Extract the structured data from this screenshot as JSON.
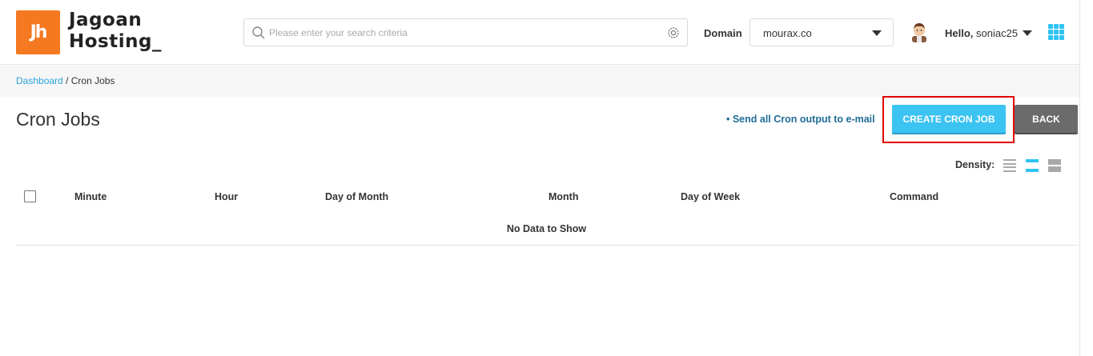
{
  "brand": {
    "logo_mark": "Jh",
    "name_line1": "Jagoan",
    "name_line2": "Hosting_"
  },
  "search": {
    "placeholder": "Please enter your search criteria",
    "value": "",
    "icon": "search-icon",
    "settings_icon": "gear-icon"
  },
  "domain": {
    "label": "Domain",
    "selected": "mourax.co"
  },
  "user": {
    "greeting": "Hello,",
    "username": "soniac25"
  },
  "breadcrumb": {
    "root": "Dashboard",
    "separator": " / ",
    "current": "Cron Jobs"
  },
  "page": {
    "title": "Cron Jobs",
    "send_link": "• Send all Cron output to e-mail",
    "create_button": "CREATE CRON JOB",
    "back_button": "BACK",
    "density_label": "Density:"
  },
  "table": {
    "columns": [
      "Minute",
      "Hour",
      "Day of Month",
      "Month",
      "Day of Week",
      "Command"
    ],
    "rows": [],
    "empty_message": "No Data to Show"
  },
  "colors": {
    "brand_orange": "#f47920",
    "accent_blue": "#3bc3f2",
    "link_blue": "#2ba4dc",
    "highlight_red": "#e00000",
    "back_gray": "#6b6b6b"
  }
}
